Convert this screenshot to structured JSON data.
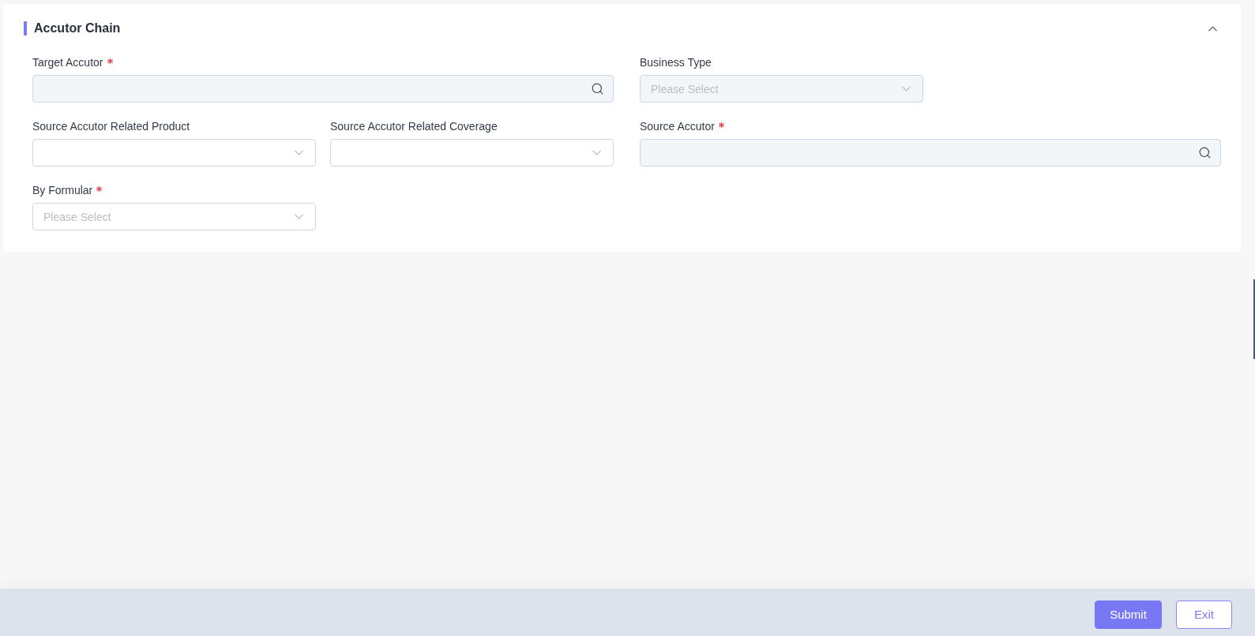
{
  "section": {
    "title": "Accutor Chain",
    "expanded": true
  },
  "form": {
    "rows": [
      {
        "fields": [
          {
            "label": "Target Accutor",
            "required": true,
            "kind": "search",
            "disabled": true
          },
          {
            "label": "Business Type",
            "required": false,
            "kind": "select",
            "disabled": true,
            "placeholder": "Please Select"
          }
        ]
      },
      {
        "fields": [
          {
            "label": "Source Accutor Related Product",
            "required": false,
            "kind": "select",
            "disabled": false
          },
          {
            "label": "Source Accutor Related Coverage",
            "required": false,
            "kind": "select",
            "disabled": false
          },
          {
            "label": "Source Accutor",
            "required": true,
            "kind": "search",
            "disabled": true
          }
        ]
      },
      {
        "fields": [
          {
            "label": "By Formular",
            "required": true,
            "kind": "select",
            "disabled": false,
            "placeholder": "Please Select"
          }
        ]
      }
    ]
  },
  "footer": {
    "buttons": [
      {
        "label": "Submit",
        "kind": "primary"
      },
      {
        "label": "Exit",
        "kind": "secondary"
      }
    ]
  }
}
